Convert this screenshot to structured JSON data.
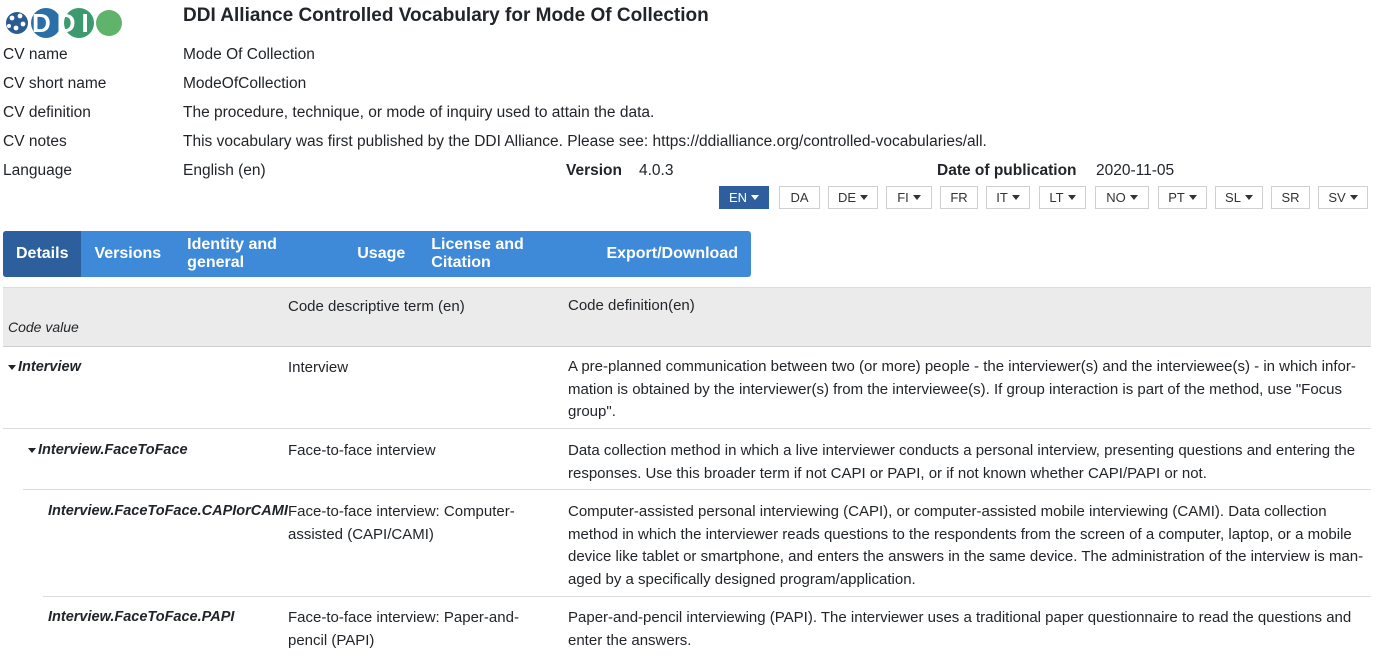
{
  "header": {
    "logo_text": "DDI",
    "title": "DDI Alliance Controlled Vocabulary for Mode Of Collection"
  },
  "meta": {
    "cv_name_label": "CV name",
    "cv_name": "Mode Of Collection",
    "cv_short_label": "CV short name",
    "cv_short": "ModeOfCollection",
    "cv_def_label": "CV definition",
    "cv_def": "The procedure, technique, or mode of inquiry used to attain the data.",
    "cv_notes_label": "CV notes",
    "cv_notes": "This vocabulary was first published by the DDI Alliance. Please see: https://ddialliance.org/controlled-vocabularies/all.",
    "language_label": "Language",
    "language": "English (en)",
    "version_label": "Version",
    "version": "4.0.3",
    "date_label": "Date of publication",
    "date": "2020-11-05"
  },
  "languages": [
    {
      "code": "EN",
      "dropdown": true,
      "active": true
    },
    {
      "code": "DA",
      "dropdown": false
    },
    {
      "code": "DE",
      "dropdown": true
    },
    {
      "code": "FI",
      "dropdown": true
    },
    {
      "code": "FR",
      "dropdown": false
    },
    {
      "code": "IT",
      "dropdown": true
    },
    {
      "code": "LT",
      "dropdown": true
    },
    {
      "code": "NO",
      "dropdown": true
    },
    {
      "code": "PT",
      "dropdown": true
    },
    {
      "code": "SL",
      "dropdown": true
    },
    {
      "code": "SR",
      "dropdown": false
    },
    {
      "code": "SV",
      "dropdown": true
    }
  ],
  "tabs": [
    "Details",
    "Versions",
    "Identity and general",
    "Usage",
    "License and Citation",
    "Export/Download"
  ],
  "table": {
    "headers": {
      "code_value": "Code value",
      "term": "Code descriptive term (en)",
      "definition": "Code definition(en)"
    },
    "rows": [
      {
        "code": "Interview",
        "term": [
          "Interview"
        ],
        "definition": [
          "A pre-planned communication between two (or more) people - the interviewer(s) and the interviewee(s) - in which infor-",
          "mation is obtained by the interviewer(s) from the interviewee(s). If group interaction is part of the method, use \"Focus",
          "group\"."
        ]
      },
      {
        "code": "Interview.FaceToFace",
        "term": [
          "Face-to-face interview"
        ],
        "definition": [
          "Data collection method in which a live interviewer conducts a personal interview, presenting questions and entering the",
          "responses. Use this broader term if not CAPI or PAPI, or if not known whether CAPI/PAPI or not."
        ]
      },
      {
        "code": "Interview.FaceToFace.CAPIorCAMI",
        "term": [
          "Face-to-face interview: Computer-",
          "assisted (CAPI/CAMI)"
        ],
        "definition": [
          "Computer-assisted personal interviewing (CAPI), or computer-assisted mobile interviewing (CAMI). Data collection",
          "method in which the interviewer reads questions to the respondents from the screen of a computer, laptop, or a mobile",
          "device like tablet or smartphone, and enters the answers in the same device. The administration of the interview is man-",
          "aged by a specifically designed program/application."
        ]
      },
      {
        "code": "Interview.FaceToFace.PAPI",
        "term": [
          "Face-to-face interview: Paper-and-",
          "pencil (PAPI)"
        ],
        "definition": [
          "Paper-and-pencil interviewing (PAPI). The interviewer uses a traditional paper questionnaire to read the questions and",
          "enter the answers."
        ]
      }
    ]
  },
  "colors": {
    "tab_bar": "#3f8ad8",
    "tab_active": "#2c5f9c",
    "lang_active": "#2f5e9e"
  }
}
